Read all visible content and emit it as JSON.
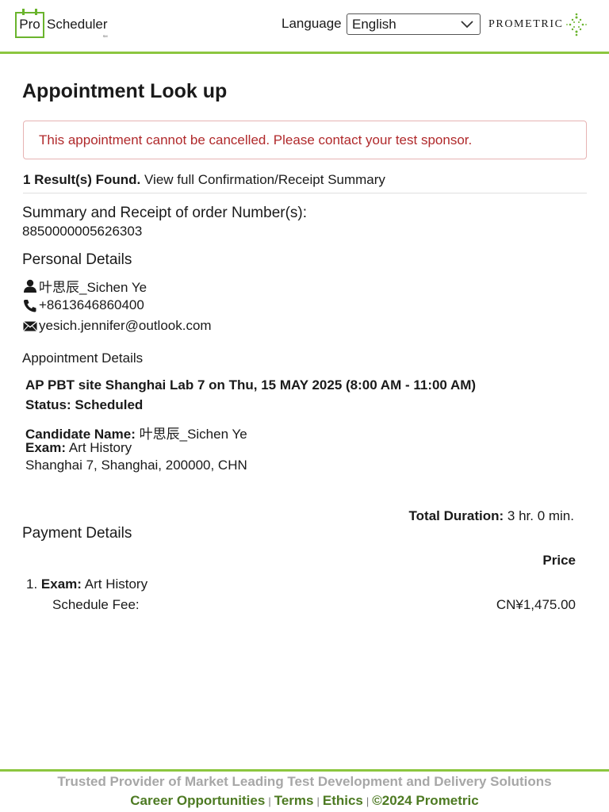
{
  "header": {
    "logo_box_text": "Pro",
    "logo_word": "Scheduler",
    "logo_mark": "SM",
    "language_label": "Language",
    "language_selected": "English",
    "brand": "PROMETRIC"
  },
  "main": {
    "title": "Appointment Look up",
    "alert": "This appointment cannot be cancelled. Please contact your test sponsor.",
    "results_count": "1 Result(s) Found.",
    "results_link": "View full Confirmation/Receipt Summary",
    "summary_heading": "Summary and Receipt of order Number(s):",
    "order_number": "8850000005626303",
    "personal_heading": "Personal Details",
    "personal": {
      "name": "叶思辰_Sichen Ye",
      "phone": "+8613646860400",
      "email": "yesich.jennifer@outlook.com"
    },
    "appointment_heading": "Appointment Details",
    "appointment": {
      "site": "AP PBT site Shanghai Lab 7 on Thu, 15 MAY 2025 (8:00 AM - 11:00 AM)",
      "status": "Status: Scheduled",
      "candidate_label": "Candidate Name:",
      "candidate_value": "叶思辰_Sichen Ye",
      "exam_label": "Exam:",
      "exam_value": "Art History",
      "address": "Shanghai 7, Shanghai, 200000, CHN"
    },
    "duration_label": "Total Duration:",
    "duration_value": "3 hr. 0 min.",
    "payment_heading": "Payment Details",
    "price_heading": "Price",
    "payment_item": {
      "number": "1.",
      "label": "Exam:",
      "value": "Art History",
      "fee_label": "Schedule Fee:",
      "fee_value": "CN¥1,475.00"
    }
  },
  "footer": {
    "tagline": "Trusted Provider of Market Leading Test Development and Delivery Solutions",
    "links": [
      "Career Opportunities",
      "Terms",
      "Ethics",
      "©2024 Prometric"
    ],
    "separator": "|"
  },
  "colors": {
    "accent_green": "#8cc63f",
    "alert_red": "#b0292b",
    "footer_link_green": "#4d7a22"
  },
  "icons": [
    "user-icon",
    "phone-icon",
    "envelope-icon",
    "chevron-down-icon",
    "prometric-star-icon"
  ]
}
